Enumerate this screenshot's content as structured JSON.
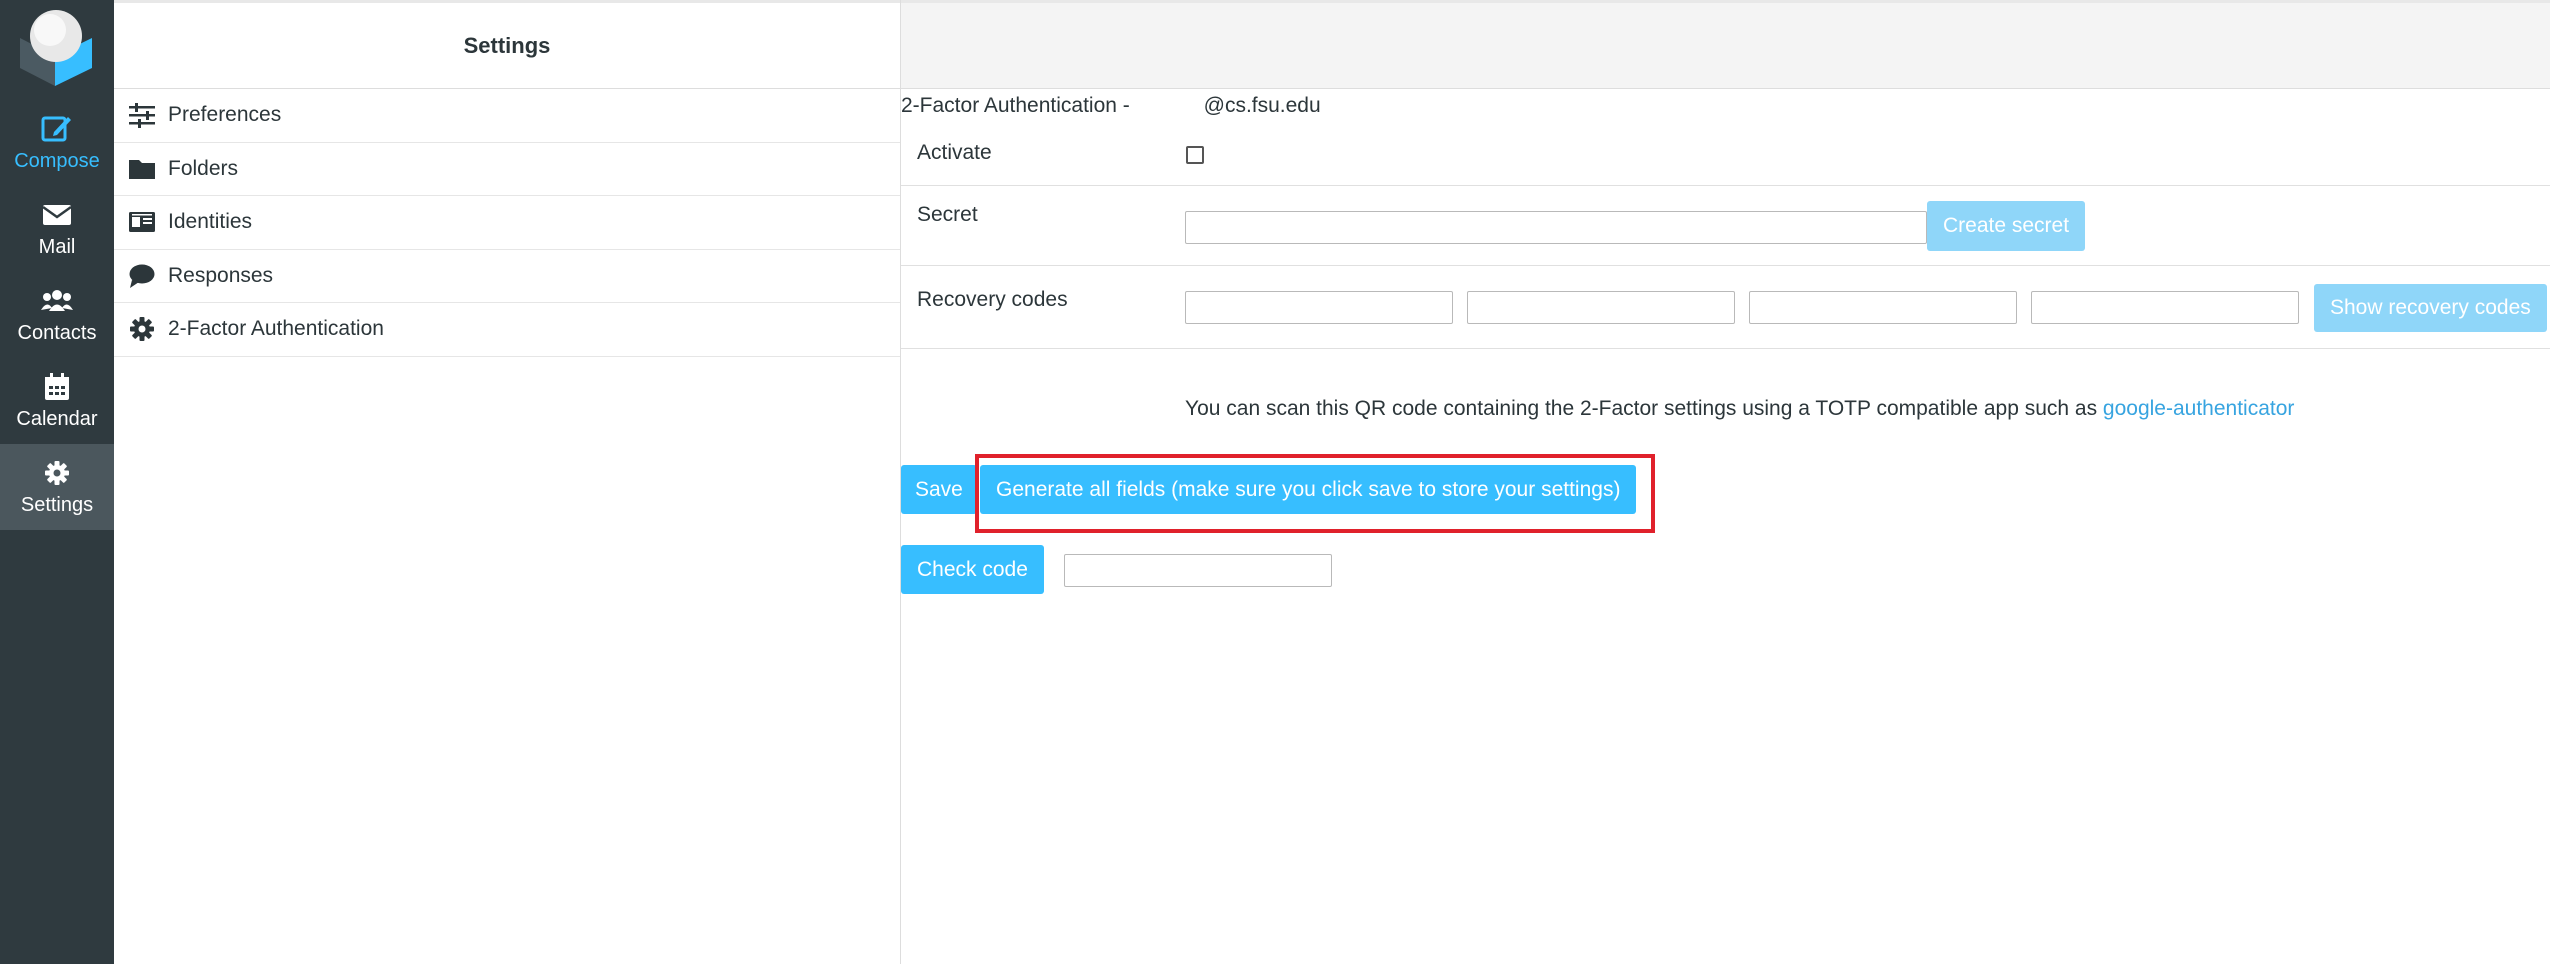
{
  "nav": {
    "items": [
      {
        "label": "Compose",
        "icon": "compose-icon"
      },
      {
        "label": "Mail",
        "icon": "mail-icon"
      },
      {
        "label": "Contacts",
        "icon": "contacts-icon"
      },
      {
        "label": "Calendar",
        "icon": "calendar-icon"
      },
      {
        "label": "Settings",
        "icon": "gear-icon"
      }
    ]
  },
  "settings": {
    "title": "Settings",
    "items": [
      {
        "label": "Preferences",
        "icon": "sliders-icon"
      },
      {
        "label": "Folders",
        "icon": "folder-icon"
      },
      {
        "label": "Identities",
        "icon": "id-card-icon"
      },
      {
        "label": "Responses",
        "icon": "comment-icon"
      },
      {
        "label": "2-Factor Authentication",
        "icon": "gear-icon"
      }
    ]
  },
  "form": {
    "title_prefix": "2-Factor Authentication - ",
    "title_suffix": "@cs.fsu.edu",
    "activate_label": "Activate",
    "secret_label": "Secret",
    "create_secret_button": "Create secret",
    "recovery_label": "Recovery codes",
    "show_recovery_button": "Show recovery codes",
    "qr_text": "You can scan this QR code containing the 2-Factor settings using a TOTP compatible app such as ",
    "qr_link": "google-authenticator",
    "save_button": "Save",
    "generate_button": "Generate all fields (make sure you click save to store your settings)",
    "check_code_button": "Check code"
  },
  "colors": {
    "accent": "#37beff",
    "accent_light": "#8fd6f9",
    "highlight": "#e0212b",
    "sidebar_bg": "#2f3a3f"
  }
}
